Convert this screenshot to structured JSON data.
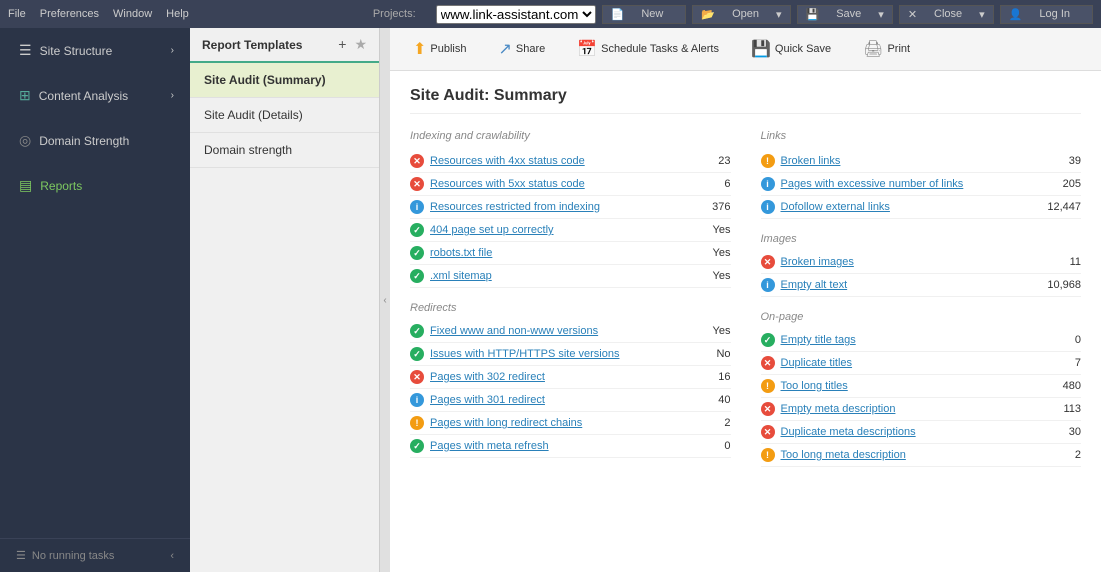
{
  "menubar": {
    "items": [
      "File",
      "Preferences",
      "Window",
      "Help"
    ],
    "project_label": "Projects:",
    "project_value": "www.link-assistant.com",
    "buttons": [
      "New",
      "Open",
      "Save",
      "Close",
      "Log In"
    ]
  },
  "sidebar": {
    "items": [
      {
        "id": "site-structure",
        "label": "Site Structure",
        "icon": "≡",
        "arrow": "›"
      },
      {
        "id": "content-analysis",
        "label": "Content Analysis",
        "icon": "📊",
        "arrow": "›"
      },
      {
        "id": "domain-strength",
        "label": "Domain Strength",
        "icon": "◎",
        "arrow": ""
      },
      {
        "id": "reports",
        "label": "Reports",
        "icon": "📋",
        "arrow": ""
      }
    ],
    "bottom_label": "No running tasks",
    "bottom_arrow": "‹"
  },
  "templates_panel": {
    "title": "Report Templates",
    "add_icon": "+",
    "star_icon": "★",
    "items": [
      {
        "id": "site-audit-summary",
        "label": "Site Audit (Summary)",
        "active": true
      },
      {
        "id": "site-audit-details",
        "label": "Site Audit (Details)",
        "active": false
      },
      {
        "id": "domain-strength",
        "label": "Domain strength",
        "active": false
      }
    ]
  },
  "toolbar": {
    "publish_label": "Publish",
    "share_label": "Share",
    "schedule_label": "Schedule Tasks & Alerts",
    "quicksave_label": "Quick Save",
    "print_label": "Print"
  },
  "report": {
    "title": "Site Audit: Summary",
    "left": {
      "sections": [
        {
          "title": "Indexing and crawlability",
          "rows": [
            {
              "type": "red",
              "label": "Resources with 4xx status code",
              "value": "23"
            },
            {
              "type": "red",
              "label": "Resources with 5xx status code",
              "value": "6"
            },
            {
              "type": "blue",
              "label": "Resources restricted from indexing",
              "value": "376"
            },
            {
              "type": "green",
              "label": "404 page set up correctly",
              "value": "Yes"
            },
            {
              "type": "green",
              "label": "robots.txt file",
              "value": "Yes"
            },
            {
              "type": "green",
              "label": ".xml sitemap",
              "value": "Yes"
            }
          ]
        },
        {
          "title": "Redirects",
          "rows": [
            {
              "type": "green",
              "label": "Fixed www and non-www versions",
              "value": "Yes"
            },
            {
              "type": "green",
              "label": "Issues with HTTP/HTTPS site versions",
              "value": "No"
            },
            {
              "type": "red",
              "label": "Pages with 302 redirect",
              "value": "16"
            },
            {
              "type": "blue",
              "label": "Pages with 301 redirect",
              "value": "40"
            },
            {
              "type": "orange",
              "label": "Pages with long redirect chains",
              "value": "2"
            },
            {
              "type": "green",
              "label": "Pages with meta refresh",
              "value": "0"
            }
          ]
        }
      ]
    },
    "right": {
      "sections": [
        {
          "title": "Links",
          "rows": [
            {
              "type": "orange",
              "label": "Broken links",
              "value": "39"
            },
            {
              "type": "blue",
              "label": "Pages with excessive number of links",
              "value": "205"
            },
            {
              "type": "blue",
              "label": "Dofollow external links",
              "value": "12,447"
            }
          ]
        },
        {
          "title": "Images",
          "rows": [
            {
              "type": "red",
              "label": "Broken images",
              "value": "11"
            },
            {
              "type": "blue",
              "label": "Empty alt text",
              "value": "10,968"
            }
          ]
        },
        {
          "title": "On-page",
          "rows": [
            {
              "type": "green",
              "label": "Empty title tags",
              "value": "0"
            },
            {
              "type": "red",
              "label": "Duplicate titles",
              "value": "7"
            },
            {
              "type": "orange",
              "label": "Too long titles",
              "value": "480"
            },
            {
              "type": "red",
              "label": "Empty meta description",
              "value": "113"
            },
            {
              "type": "red",
              "label": "Duplicate meta descriptions",
              "value": "30"
            },
            {
              "type": "orange",
              "label": "Too long meta description",
              "value": "2"
            }
          ]
        }
      ]
    }
  }
}
